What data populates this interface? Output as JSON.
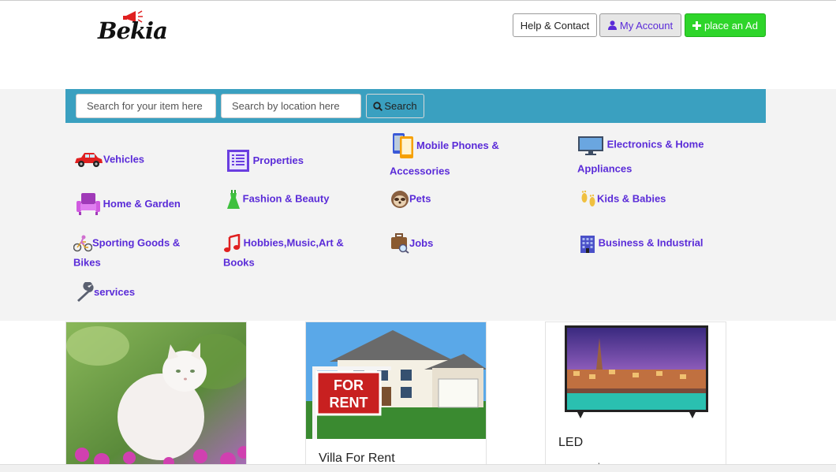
{
  "brand": {
    "logo_text": "Bekia"
  },
  "header": {
    "help_label": "Help & Contact",
    "account_label": "My Account",
    "place_ad_label": "place an Ad"
  },
  "search": {
    "item_placeholder": "Search for your item here",
    "location_placeholder": "Search by location here",
    "button_label": "Search"
  },
  "categories": [
    {
      "label": "Vehicles",
      "icon": "car-icon"
    },
    {
      "label": "Properties",
      "icon": "list-icon"
    },
    {
      "label": "Mobile Phones & Accessories",
      "icon": "mobile-phone-icon"
    },
    {
      "label": "Electronics & Home Appliances",
      "icon": "monitor-icon"
    },
    {
      "label": "Home & Garden",
      "icon": "armchair-icon"
    },
    {
      "label": "Fashion & Beauty",
      "icon": "dress-icon"
    },
    {
      "label": "Pets",
      "icon": "sloth-icon"
    },
    {
      "label": "Kids & Babies",
      "icon": "footprints-icon"
    },
    {
      "label": "Sporting Goods & Bikes",
      "icon": "cyclist-icon"
    },
    {
      "label": "Hobbies,Music,Art & Books",
      "icon": "music-note-icon"
    },
    {
      "label": "Jobs",
      "icon": "briefcase-icon"
    },
    {
      "label": "Business & Industrial",
      "icon": "office-building-icon"
    },
    {
      "label": "services",
      "icon": "wrench-icon"
    }
  ],
  "listings": [
    {
      "title": "",
      "subtitle": ""
    },
    {
      "title": "Villa For Rent",
      "subtitle": ""
    },
    {
      "title": "LED",
      "subtitle": "very good case"
    }
  ],
  "colors": {
    "link": "#5a2bd8",
    "search_bar": "#3aa0c0",
    "place_ad_button": "#2ed52a",
    "band_background": "#f3f3f3"
  }
}
